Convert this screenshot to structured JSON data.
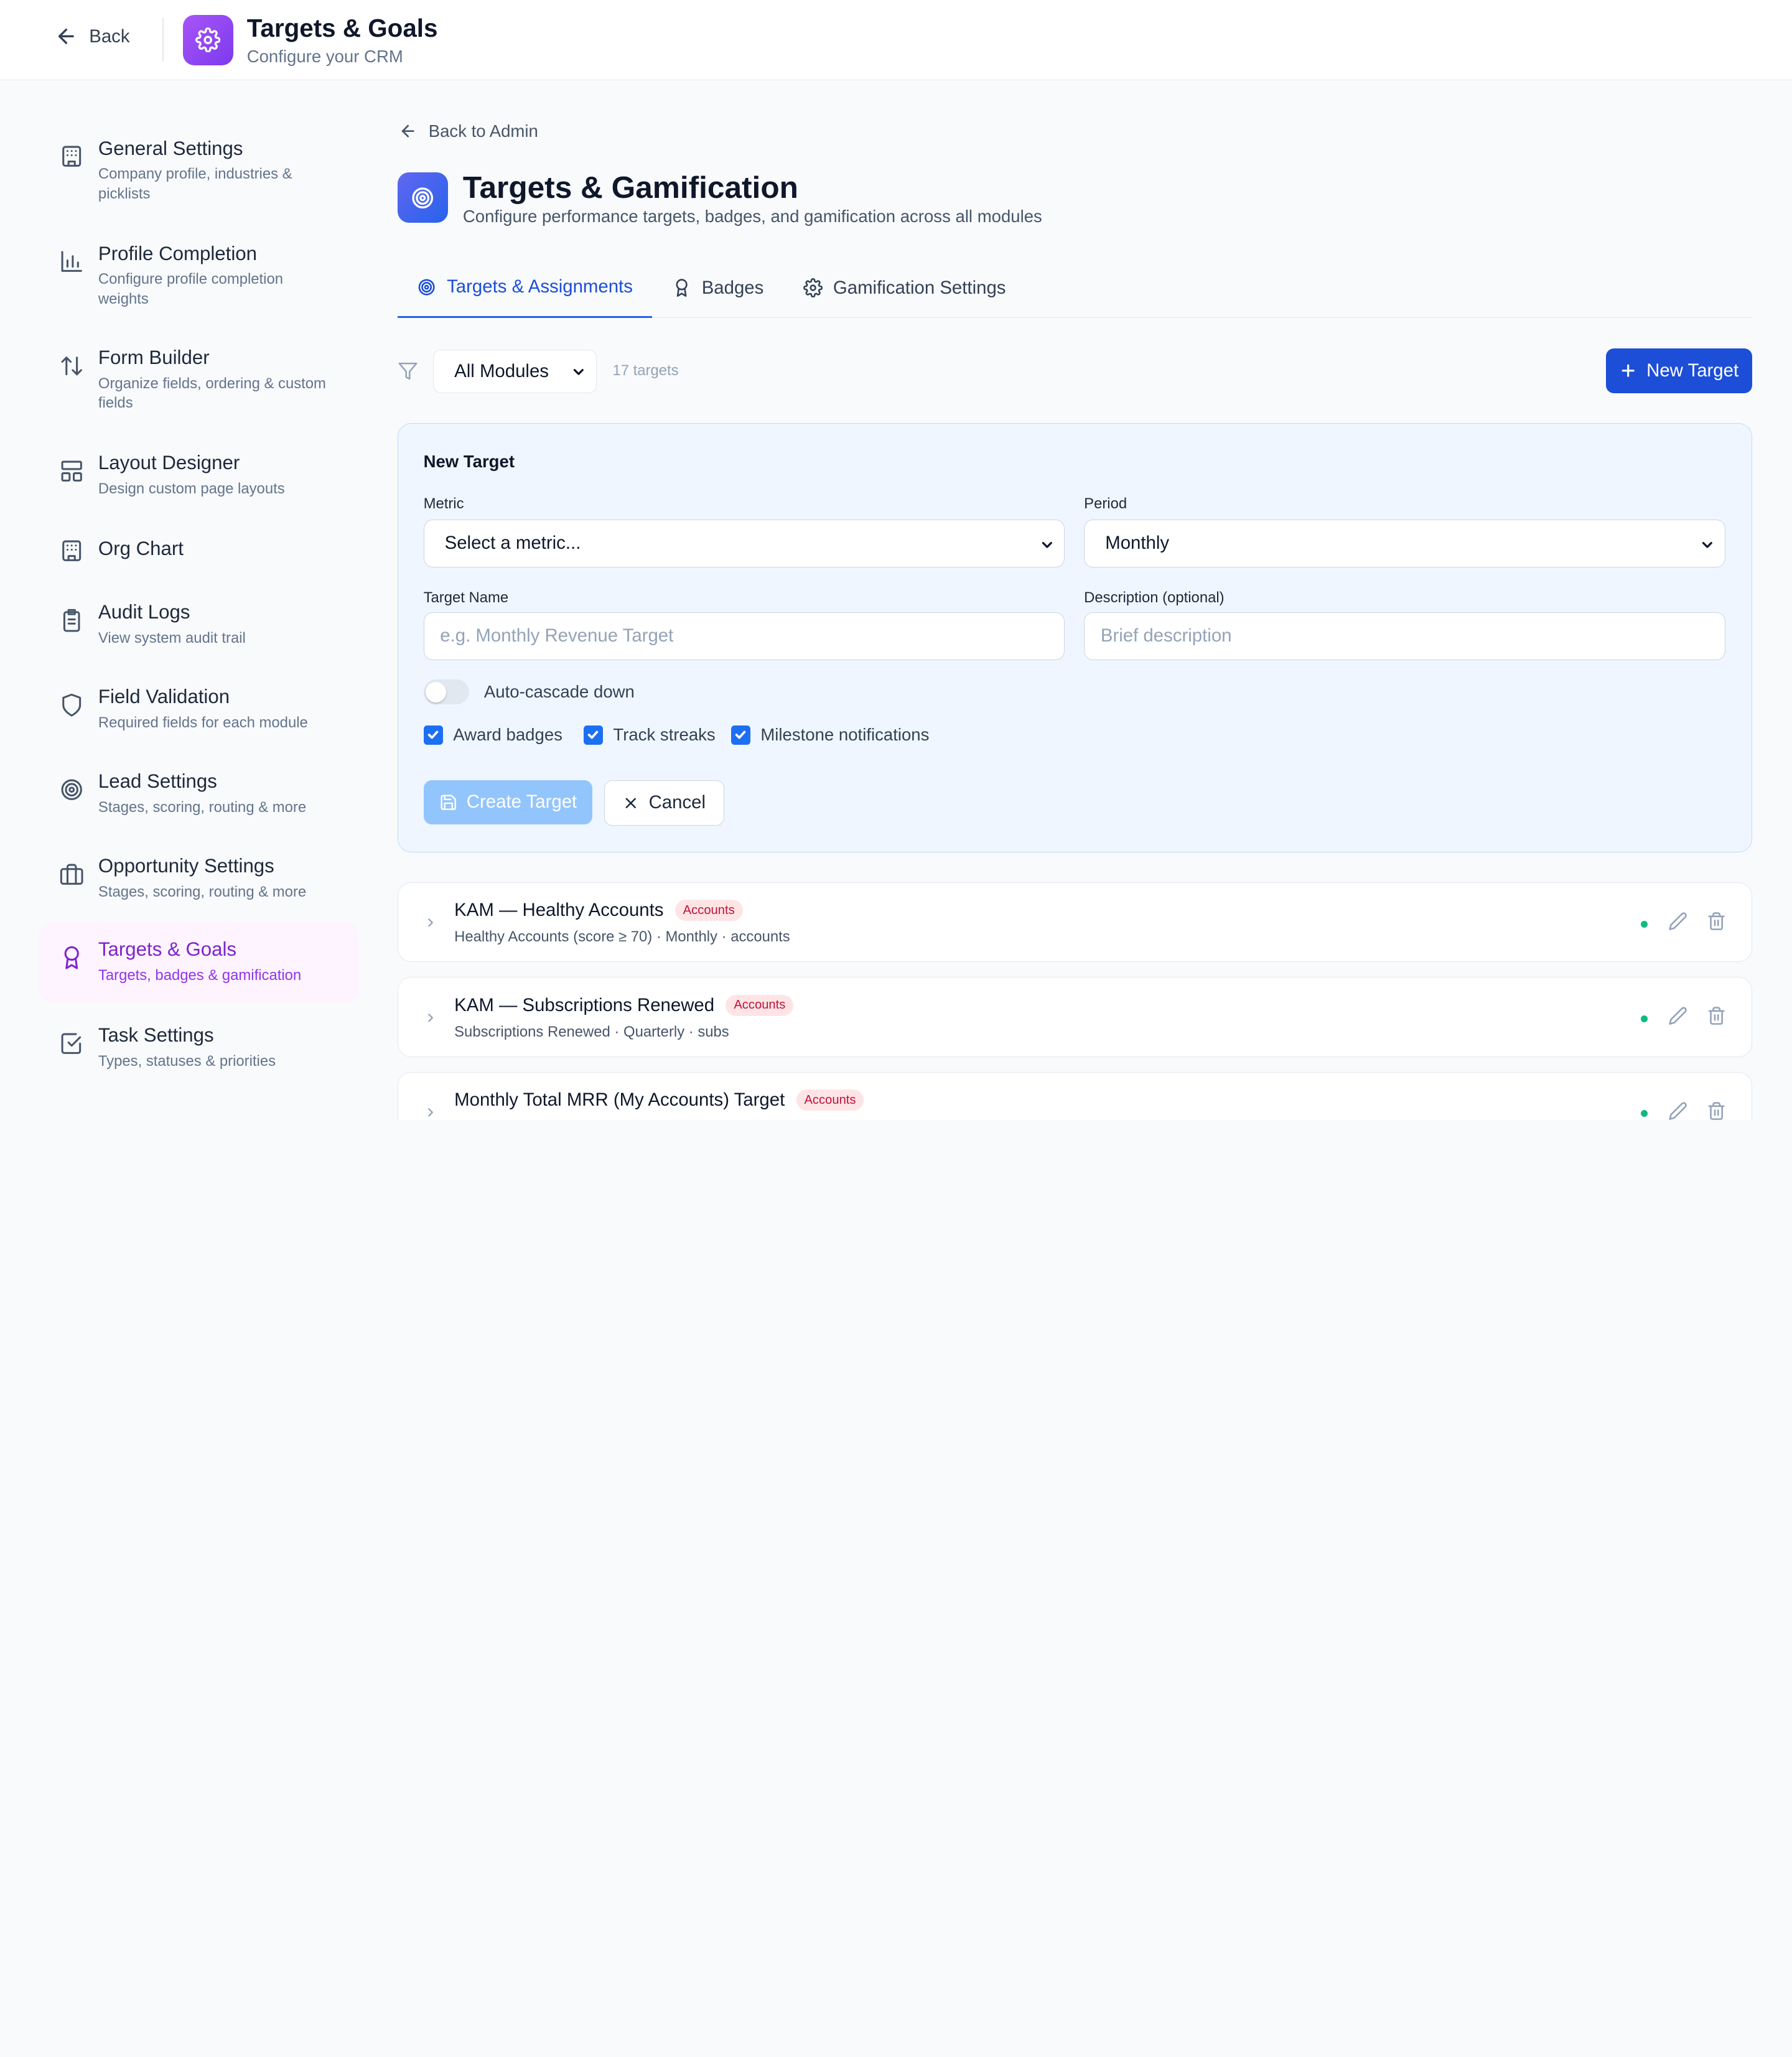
{
  "header": {
    "back_label": "Back",
    "title": "Targets & Goals",
    "subtitle": "Configure your CRM",
    "brand_color": "#7c3aed"
  },
  "sidebar": {
    "items": [
      {
        "label": "General Settings",
        "desc": "Company profile, industries & picklists",
        "icon": "building-icon"
      },
      {
        "label": "Profile Completion",
        "desc": "Configure profile completion weights",
        "icon": "bar-chart-icon"
      },
      {
        "label": "Form Builder",
        "desc": "Organize fields, ordering & custom fields",
        "icon": "sort-arrows-icon"
      },
      {
        "label": "Layout Designer",
        "desc": "Design custom page layouts",
        "icon": "layout-icon"
      },
      {
        "label": "Org Chart",
        "desc": "",
        "icon": "building-icon"
      },
      {
        "label": "Audit Logs",
        "desc": "View system audit trail",
        "icon": "clipboard-icon"
      },
      {
        "label": "Field Validation",
        "desc": "Required fields for each module",
        "icon": "shield-icon"
      },
      {
        "label": "Lead Settings",
        "desc": "Stages, scoring, routing & more",
        "icon": "target-icon"
      },
      {
        "label": "Opportunity Settings",
        "desc": "Stages, scoring, routing & more",
        "icon": "briefcase-icon"
      },
      {
        "label": "Targets & Goals",
        "desc": "Targets, badges & gamification",
        "icon": "award-icon",
        "active": true
      },
      {
        "label": "Task Settings",
        "desc": "Types, statuses & priorities",
        "icon": "checkbox-icon"
      }
    ]
  },
  "main": {
    "back_admin_label": "Back to Admin",
    "title": "Targets & Gamification",
    "subtitle": "Configure performance targets, badges, and gamification across all modules",
    "tabs": [
      {
        "label": "Targets & Assignments",
        "icon": "target-icon",
        "active": true
      },
      {
        "label": "Badges",
        "icon": "award-icon"
      },
      {
        "label": "Gamification Settings",
        "icon": "gear-icon"
      }
    ],
    "filter": {
      "module_selected": "All Modules",
      "count_text": "17 targets"
    },
    "new_target_label": "New Target",
    "accent_color": "#1d4ed8"
  },
  "form": {
    "heading": "New Target",
    "metric_label": "Metric",
    "metric_value": "Select a metric...",
    "period_label": "Period",
    "period_value": "Monthly",
    "name_label": "Target Name",
    "name_placeholder": "e.g. Monthly Revenue Target",
    "desc_label": "Description (optional)",
    "desc_placeholder": "Brief description",
    "cascade_label": "Auto-cascade down",
    "cascade_on": false,
    "checkboxes": [
      {
        "label": "Award badges",
        "checked": true
      },
      {
        "label": "Track streaks",
        "checked": true
      },
      {
        "label": "Milestone notifications",
        "checked": true
      }
    ],
    "create_label": "Create Target",
    "cancel_label": "Cancel"
  },
  "targets": [
    {
      "title": "KAM — Healthy Accounts",
      "badge": "Accounts",
      "sub": "Healthy Accounts (score ≥ 70) · Monthly · accounts",
      "status_color": "#10b981"
    },
    {
      "title": "KAM — Subscriptions Renewed",
      "badge": "Accounts",
      "sub": "Subscriptions Renewed · Quarterly · subs",
      "status_color": "#10b981"
    },
    {
      "title": "Monthly Total MRR (My Accounts) Target",
      "badge": "Accounts",
      "sub": "",
      "status_color": "#10b981"
    }
  ]
}
